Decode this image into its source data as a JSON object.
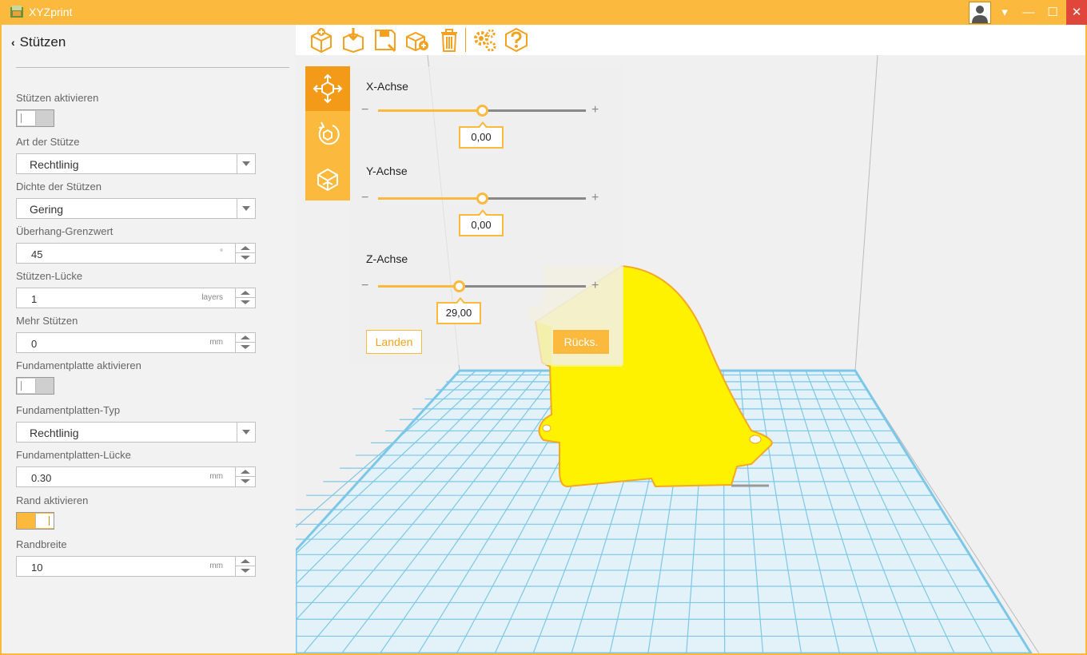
{
  "window": {
    "title": "XYZprint",
    "controls": {
      "dropdown": "▾",
      "minimize": "—",
      "maximize": "☐",
      "close": "✕"
    }
  },
  "sidebar": {
    "page_title": "Stützen",
    "back_icon": "chevron-left-icon",
    "settings": {
      "supports_enable": {
        "label": "Stützen aktivieren",
        "on": false
      },
      "support_type": {
        "label": "Art der Stütze",
        "value": "Rechtlinig"
      },
      "support_density": {
        "label": "Dichte der Stützen",
        "value": "Gering"
      },
      "overhang_threshold": {
        "label": "Überhang-Grenzwert",
        "value": "45",
        "unit": "°"
      },
      "support_gap": {
        "label": "Stützen-Lücke",
        "value": "1",
        "unit": "layers"
      },
      "more_supports": {
        "label": "Mehr Stützen",
        "value": "0",
        "unit": "mm"
      },
      "raft_enable": {
        "label": "Fundamentplatte aktivieren",
        "on": false
      },
      "raft_type": {
        "label": "Fundamentplatten-Typ",
        "value": "Rechtlinig"
      },
      "raft_gap": {
        "label": "Fundamentplatten-Lücke",
        "value": "0.30",
        "unit": "mm"
      },
      "brim_enable": {
        "label": "Rand aktivieren",
        "on": true
      },
      "brim_width": {
        "label": "Randbreite",
        "value": "10",
        "unit": "mm"
      }
    }
  },
  "toolbar": {
    "icons": [
      "import-model-icon",
      "download-icon",
      "save-icon",
      "add-model-icon",
      "trash-icon",
      "settings-icon",
      "help-icon"
    ]
  },
  "transform_panel": {
    "tabs": [
      "move-tool-icon",
      "rotate-tool-icon",
      "scale-tool-icon"
    ],
    "active_tab": "move-tool-icon",
    "x_axis": {
      "label": "X-Achse",
      "value": "0,00",
      "slider_fraction": 0.5
    },
    "y_axis": {
      "label": "Y-Achse",
      "value": "0,00",
      "slider_fraction": 0.5
    },
    "z_axis": {
      "label": "Z-Achse",
      "value": "29,00",
      "slider_fraction": 0.39
    },
    "minus": "−",
    "plus": "+",
    "land_button": "Landen",
    "reset_button": "Rücks."
  },
  "colors": {
    "accent": "#fbb93d",
    "accent_dark": "#f39a19",
    "model_fill": "#fff200",
    "model_edge": "#f6a723",
    "grid": "#7cc7e8",
    "close": "#e0463a"
  }
}
